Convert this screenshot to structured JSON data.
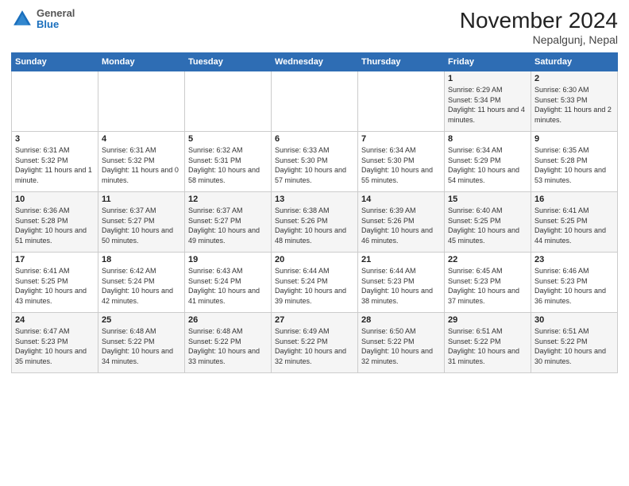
{
  "logo": {
    "general": "General",
    "blue": "Blue"
  },
  "header": {
    "month": "November 2024",
    "location": "Nepalgunj, Nepal"
  },
  "weekdays": [
    "Sunday",
    "Monday",
    "Tuesday",
    "Wednesday",
    "Thursday",
    "Friday",
    "Saturday"
  ],
  "weeks": [
    [
      {
        "day": "",
        "info": ""
      },
      {
        "day": "",
        "info": ""
      },
      {
        "day": "",
        "info": ""
      },
      {
        "day": "",
        "info": ""
      },
      {
        "day": "",
        "info": ""
      },
      {
        "day": "1",
        "info": "Sunrise: 6:29 AM\nSunset: 5:34 PM\nDaylight: 11 hours and 4 minutes."
      },
      {
        "day": "2",
        "info": "Sunrise: 6:30 AM\nSunset: 5:33 PM\nDaylight: 11 hours and 2 minutes."
      }
    ],
    [
      {
        "day": "3",
        "info": "Sunrise: 6:31 AM\nSunset: 5:32 PM\nDaylight: 11 hours and 1 minute."
      },
      {
        "day": "4",
        "info": "Sunrise: 6:31 AM\nSunset: 5:32 PM\nDaylight: 11 hours and 0 minutes."
      },
      {
        "day": "5",
        "info": "Sunrise: 6:32 AM\nSunset: 5:31 PM\nDaylight: 10 hours and 58 minutes."
      },
      {
        "day": "6",
        "info": "Sunrise: 6:33 AM\nSunset: 5:30 PM\nDaylight: 10 hours and 57 minutes."
      },
      {
        "day": "7",
        "info": "Sunrise: 6:34 AM\nSunset: 5:30 PM\nDaylight: 10 hours and 55 minutes."
      },
      {
        "day": "8",
        "info": "Sunrise: 6:34 AM\nSunset: 5:29 PM\nDaylight: 10 hours and 54 minutes."
      },
      {
        "day": "9",
        "info": "Sunrise: 6:35 AM\nSunset: 5:28 PM\nDaylight: 10 hours and 53 minutes."
      }
    ],
    [
      {
        "day": "10",
        "info": "Sunrise: 6:36 AM\nSunset: 5:28 PM\nDaylight: 10 hours and 51 minutes."
      },
      {
        "day": "11",
        "info": "Sunrise: 6:37 AM\nSunset: 5:27 PM\nDaylight: 10 hours and 50 minutes."
      },
      {
        "day": "12",
        "info": "Sunrise: 6:37 AM\nSunset: 5:27 PM\nDaylight: 10 hours and 49 minutes."
      },
      {
        "day": "13",
        "info": "Sunrise: 6:38 AM\nSunset: 5:26 PM\nDaylight: 10 hours and 48 minutes."
      },
      {
        "day": "14",
        "info": "Sunrise: 6:39 AM\nSunset: 5:26 PM\nDaylight: 10 hours and 46 minutes."
      },
      {
        "day": "15",
        "info": "Sunrise: 6:40 AM\nSunset: 5:25 PM\nDaylight: 10 hours and 45 minutes."
      },
      {
        "day": "16",
        "info": "Sunrise: 6:41 AM\nSunset: 5:25 PM\nDaylight: 10 hours and 44 minutes."
      }
    ],
    [
      {
        "day": "17",
        "info": "Sunrise: 6:41 AM\nSunset: 5:25 PM\nDaylight: 10 hours and 43 minutes."
      },
      {
        "day": "18",
        "info": "Sunrise: 6:42 AM\nSunset: 5:24 PM\nDaylight: 10 hours and 42 minutes."
      },
      {
        "day": "19",
        "info": "Sunrise: 6:43 AM\nSunset: 5:24 PM\nDaylight: 10 hours and 41 minutes."
      },
      {
        "day": "20",
        "info": "Sunrise: 6:44 AM\nSunset: 5:24 PM\nDaylight: 10 hours and 39 minutes."
      },
      {
        "day": "21",
        "info": "Sunrise: 6:44 AM\nSunset: 5:23 PM\nDaylight: 10 hours and 38 minutes."
      },
      {
        "day": "22",
        "info": "Sunrise: 6:45 AM\nSunset: 5:23 PM\nDaylight: 10 hours and 37 minutes."
      },
      {
        "day": "23",
        "info": "Sunrise: 6:46 AM\nSunset: 5:23 PM\nDaylight: 10 hours and 36 minutes."
      }
    ],
    [
      {
        "day": "24",
        "info": "Sunrise: 6:47 AM\nSunset: 5:23 PM\nDaylight: 10 hours and 35 minutes."
      },
      {
        "day": "25",
        "info": "Sunrise: 6:48 AM\nSunset: 5:22 PM\nDaylight: 10 hours and 34 minutes."
      },
      {
        "day": "26",
        "info": "Sunrise: 6:48 AM\nSunset: 5:22 PM\nDaylight: 10 hours and 33 minutes."
      },
      {
        "day": "27",
        "info": "Sunrise: 6:49 AM\nSunset: 5:22 PM\nDaylight: 10 hours and 32 minutes."
      },
      {
        "day": "28",
        "info": "Sunrise: 6:50 AM\nSunset: 5:22 PM\nDaylight: 10 hours and 32 minutes."
      },
      {
        "day": "29",
        "info": "Sunrise: 6:51 AM\nSunset: 5:22 PM\nDaylight: 10 hours and 31 minutes."
      },
      {
        "day": "30",
        "info": "Sunrise: 6:51 AM\nSunset: 5:22 PM\nDaylight: 10 hours and 30 minutes."
      }
    ]
  ]
}
